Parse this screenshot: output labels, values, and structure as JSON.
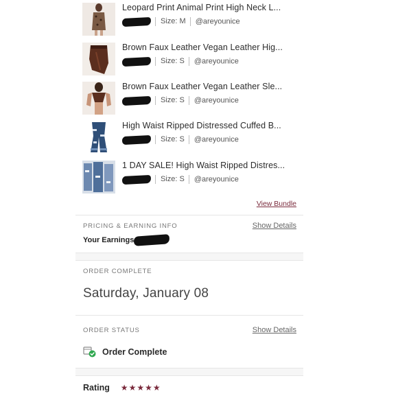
{
  "items": [
    {
      "title": "Leopard Print Animal Print High Neck L...",
      "size_label": "Size: M",
      "seller": "@areyounice"
    },
    {
      "title": "Brown Faux Leather Vegan Leather Hig...",
      "size_label": "Size: S",
      "seller": "@areyounice"
    },
    {
      "title": "Brown Faux Leather Vegan Leather Sle...",
      "size_label": "Size: S",
      "seller": "@areyounice"
    },
    {
      "title": "High Waist Ripped Distressed Cuffed B...",
      "size_label": "Size: S",
      "seller": "@areyounice"
    },
    {
      "title": "1 DAY SALE! High Waist Ripped Distres...",
      "size_label": "Size: S",
      "seller": "@areyounice"
    }
  ],
  "bundle": {
    "view_label": "View Bundle"
  },
  "pricing": {
    "heading": "PRICING & EARNING INFO",
    "show_details": "Show Details",
    "earnings_label": "Your Earnings"
  },
  "order_complete": {
    "heading": "ORDER COMPLETE",
    "date": "Saturday, January 08"
  },
  "order_status": {
    "heading": "ORDER STATUS",
    "show_details": "Show Details",
    "status": "Order Complete"
  },
  "rating": {
    "label": "Rating",
    "stars": 5
  },
  "colors": {
    "accent": "#7a2a3c",
    "status_green": "#2fa84f"
  },
  "icons": {
    "status": "package-check-icon",
    "star": "star-icon"
  }
}
